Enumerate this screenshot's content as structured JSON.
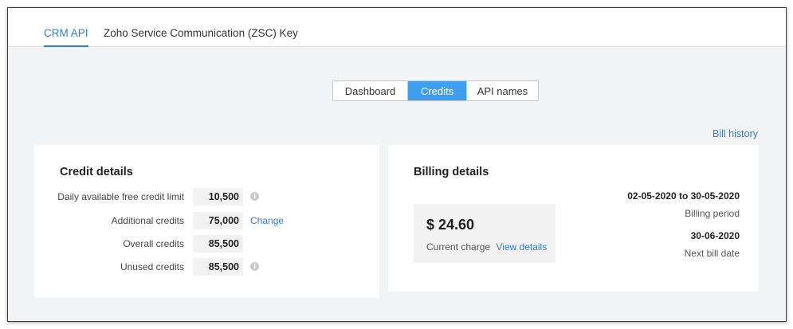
{
  "tabs": {
    "items": [
      {
        "label": "CRM API",
        "active": true
      },
      {
        "label": "Zoho Service Communication (ZSC) Key",
        "active": false
      }
    ]
  },
  "segmented": {
    "items": [
      {
        "label": "Dashboard",
        "active": false
      },
      {
        "label": "Credits",
        "active": true
      },
      {
        "label": "API names",
        "active": false
      }
    ]
  },
  "bill_history_label": "Bill history",
  "credit_details": {
    "title": "Credit details",
    "rows": [
      {
        "label": "Daily available free credit limit",
        "value": "10,500",
        "extra": "info-icon"
      },
      {
        "label": "Additional credits",
        "value": "75,000",
        "extra": "Change"
      },
      {
        "label": "Overall credits",
        "value": "85,500",
        "extra": ""
      },
      {
        "label": "Unused credits",
        "value": "85,500",
        "extra": "info-icon"
      }
    ]
  },
  "billing_details": {
    "title": "Billing details",
    "current_charge": {
      "amount": "$ 24.60",
      "label": "Current charge",
      "link": "View details"
    },
    "billing_period": {
      "value": "02-05-2020 to 30-05-2020",
      "label": "Billing period"
    },
    "next_bill": {
      "value": "30-06-2020",
      "label": "Next bill date"
    }
  },
  "colors": {
    "accent": "#2b7fd8",
    "segment_active": "#3e9ff0",
    "background": "#f2f3f5"
  }
}
